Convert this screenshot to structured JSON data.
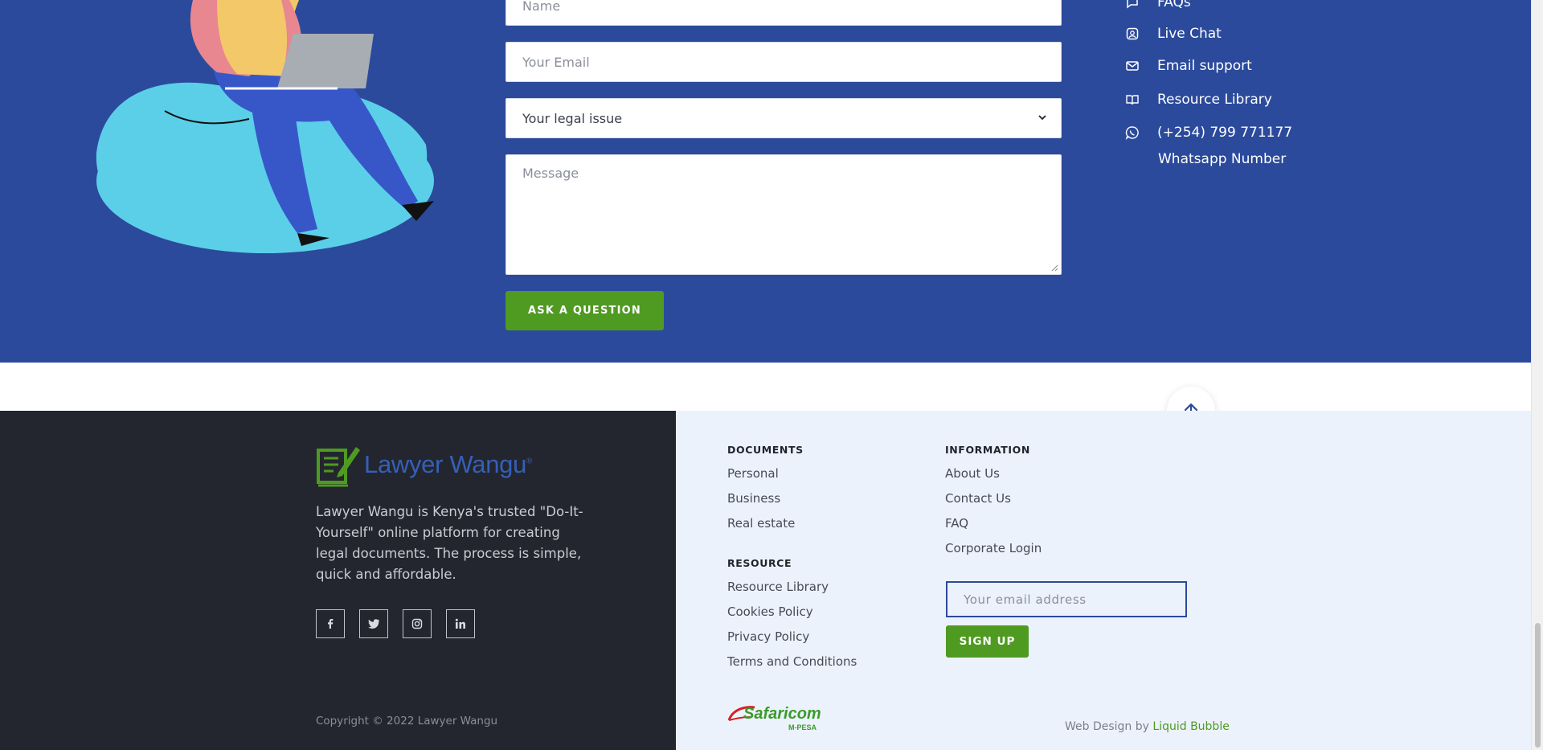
{
  "contact_form": {
    "name_placeholder": "Name",
    "email_placeholder": "Your Email",
    "legal_issue_value": "Your legal issue",
    "message_placeholder": "Message",
    "submit_label": "ASK A QUESTION"
  },
  "support_links": {
    "faqs": "FAQs",
    "live_chat": "Live Chat",
    "email_support": "Email support",
    "resource_library": "Resource Library",
    "whatsapp_phone": "(+254) 799 771177",
    "whatsapp_label": "Whatsapp Number"
  },
  "footer": {
    "brand": "Lawyer Wangu",
    "brand_mark": "®",
    "about": "Lawyer Wangu is Kenya's trusted \"Do-It-Yourself\" online platform for creating legal documents. The process is simple, quick and affordable.",
    "copyright": "Copyright © 2022 Lawyer Wangu",
    "documents_heading": "DOCUMENTS",
    "documents": [
      "Personal",
      "Business",
      "Real estate"
    ],
    "resource_heading": "RESOURCE",
    "resources": [
      "Resource Library",
      "Cookies Policy",
      "Privacy Policy",
      "Terms and Conditions"
    ],
    "information_heading": "INFORMATION",
    "information": [
      "About Us",
      "Contact Us",
      "FAQ",
      "Corporate Login"
    ],
    "newsletter_placeholder": "Your email address",
    "signup_label": "SIGN UP",
    "safaricom_logo": "Safaricom",
    "mpesa_text": "M-PESA",
    "web_design_prefix": "Web Design by ",
    "web_design_link": "Liquid Bubble"
  },
  "colors": {
    "contact_bg": "#2b4a9c",
    "accent_green": "#4f9a21",
    "footer_dark": "#23262e",
    "footer_light": "#ecf2fc"
  }
}
